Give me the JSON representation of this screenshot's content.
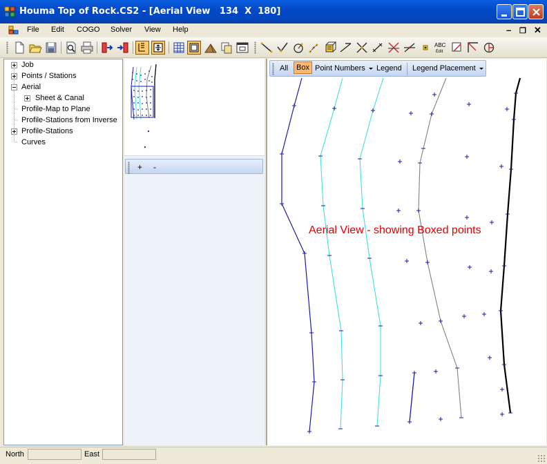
{
  "window": {
    "title": "Houma Top of Rock.CS2 - [Aerial View   134  X  180]",
    "app_icon": "app-icon",
    "accent_color": "#0348C8"
  },
  "menu": {
    "items": [
      "File",
      "Edit",
      "COGO",
      "Solver",
      "View",
      "Help"
    ],
    "mdi_icon": "mdi-child-icon"
  },
  "toolbar": {
    "buttons": [
      "new-icon",
      "open-icon",
      "save-icon",
      "print-preview-icon",
      "print-icon",
      "import-icon",
      "export-icon",
      "edit-icon",
      "zoom-extents-icon",
      "grid-icon",
      "layout-icon",
      "surface-icon",
      "copy-icon",
      "window-icon",
      "line-icon",
      "check-line-icon",
      "curve-icon",
      "points-icon",
      "cube-icon",
      "offset-icon",
      "intersect-icon",
      "measure-icon",
      "x-point-icon",
      "angle-icon",
      "point-icon",
      "abc-edit-icon",
      "select-icon",
      "polyline-icon",
      "circle-icon"
    ],
    "abc_label": "ABC",
    "abc_sub": "Edit"
  },
  "tree": {
    "items": [
      {
        "label": "Job",
        "expander": "plus"
      },
      {
        "label": "Points / Stations",
        "expander": "plus"
      },
      {
        "label": "Aerial",
        "expander": "minus"
      },
      {
        "label": "Sheet & Canal",
        "expander": "plus"
      },
      {
        "label": "Profile-Map to Plane",
        "expander": "none"
      },
      {
        "label": "Profile-Stations from Inverse",
        "expander": "none"
      },
      {
        "label": "Profile-Stations",
        "expander": "plus"
      },
      {
        "label": "Curves",
        "expander": "none"
      }
    ]
  },
  "zoom": {
    "plus": "+",
    "minus": "-"
  },
  "view_toolbar": {
    "all": "All",
    "box": "Box",
    "point_numbers": "Point Numbers",
    "legend": "Legend",
    "legend_placement": "Legend Placement"
  },
  "canvas": {
    "annotation": "Aerial View - showing Boxed points",
    "annotation_color": "#E30000",
    "line_colors": [
      "#1A1AA8",
      "#40E0E0",
      "#808080",
      "#000000"
    ],
    "point_color": "#1A1AA8"
  },
  "status": {
    "north_label": "North",
    "north_value": "",
    "east_label": "East",
    "east_value": ""
  }
}
